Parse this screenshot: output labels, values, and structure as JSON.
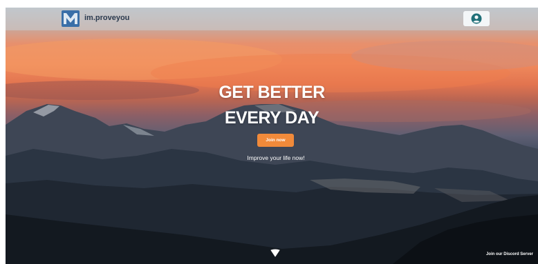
{
  "header": {
    "brand_name": "im.proveyou",
    "logo_icon": "m-logo-icon",
    "profile_icon": "user-circle-icon"
  },
  "hero": {
    "headline_line1": "GET BETTER",
    "headline_line2": "EVERY DAY",
    "join_button_label": "Join now",
    "subtitle": "Improve your life now!",
    "scroll_icon": "chevron-down-icon"
  },
  "footer": {
    "discord_label": "Join our Discord Server"
  },
  "colors": {
    "accent": "#f18a3a",
    "header_text": "#2b3a4e",
    "logo_blue": "#3a6fa8",
    "profile_icon": "#1f6f78"
  }
}
